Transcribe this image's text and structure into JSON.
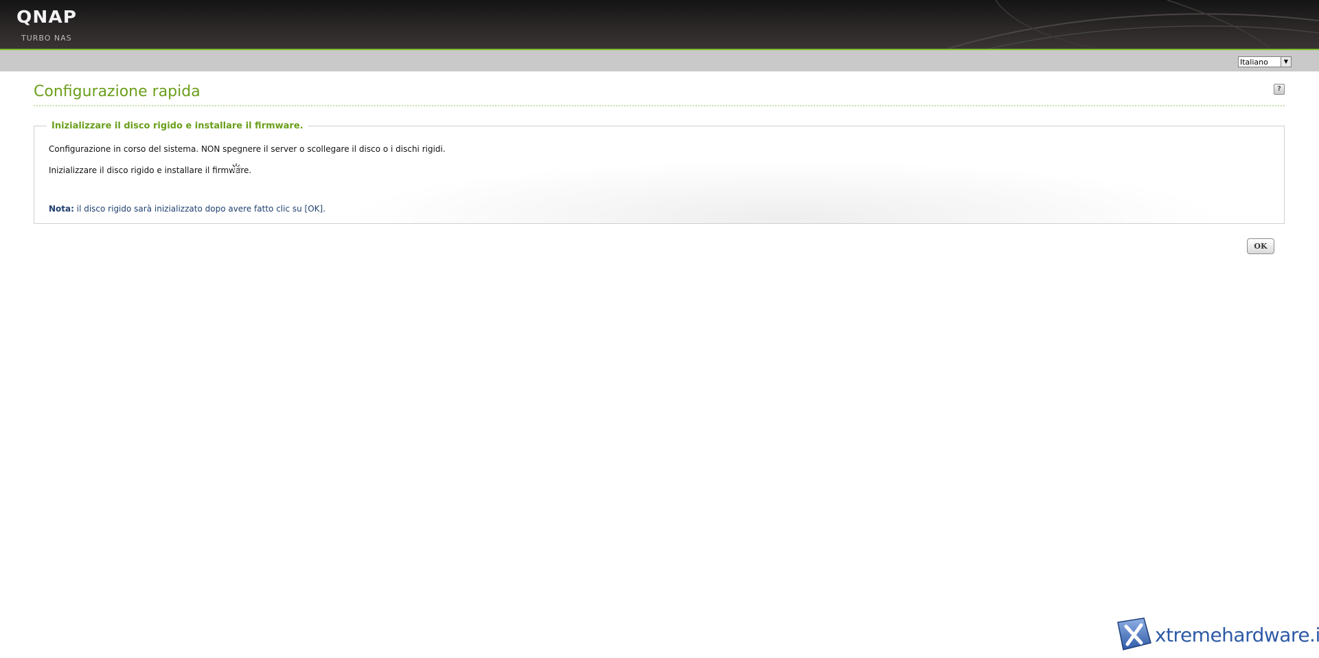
{
  "header": {
    "logo_text": "QNAP",
    "sublogo_text": "TURBO NAS"
  },
  "language": {
    "selected": "Italiano"
  },
  "page": {
    "title": "Configurazione rapida",
    "help_icon_glyph": "?"
  },
  "section": {
    "legend": "Inizializzare il disco rigido e installare il firmware.",
    "message_1": "Configurazione in corso del sistema. NON spegnere il server o scollegare il disco o i dischi rigidi.",
    "message_2": "Inizializzare il disco rigido e installare il firmware.",
    "note_label": "Nota:",
    "note_text": " il disco rigido sarà inizializzato dopo avere fatto clic su [OK]."
  },
  "actions": {
    "ok_label": "OK"
  },
  "watermark": {
    "text": "xtremehardware.it"
  },
  "colors": {
    "accent_green": "#6a9e1a",
    "note_blue": "#1f3f6e",
    "header_dark": "#2b2727"
  },
  "icons": {
    "help": "help-icon",
    "spinner": "loading-spinner-icon",
    "dropdown": "chevron-down-icon"
  }
}
